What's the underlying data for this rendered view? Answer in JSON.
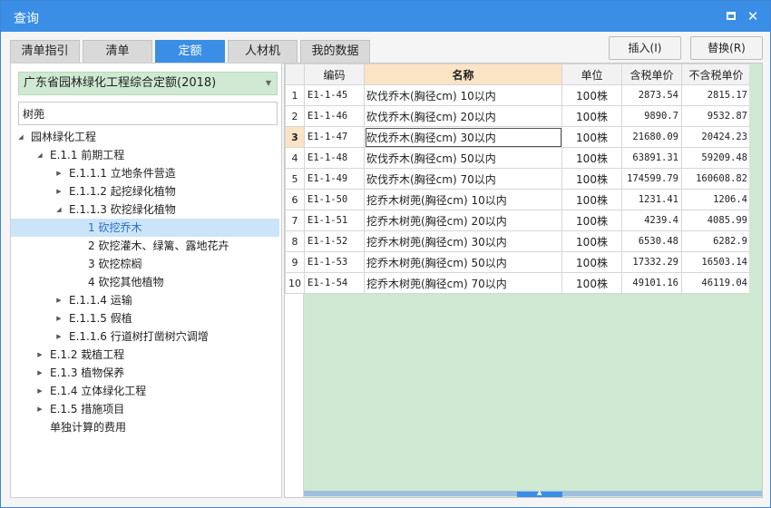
{
  "window": {
    "title": "查询"
  },
  "tabs": [
    "清单指引",
    "清单",
    "定额",
    "人材机",
    "我的数据"
  ],
  "active_tab": 2,
  "actions": {
    "insert": "插入(I)",
    "replace": "替换(R)"
  },
  "left": {
    "select_value": "广东省园林绿化工程综合定额(2018)",
    "search_value": "树蔸",
    "tree": [
      {
        "label": "园林绿化工程",
        "level": 0,
        "toggle": "expanded"
      },
      {
        "label": "E.1.1 前期工程",
        "level": 1,
        "toggle": "expanded"
      },
      {
        "label": "E.1.1.1 立地条件营造",
        "level": 2,
        "toggle": "collapsed"
      },
      {
        "label": "E.1.1.2 起挖绿化植物",
        "level": 2,
        "toggle": "collapsed"
      },
      {
        "label": "E.1.1.3 砍挖绿化植物",
        "level": 2,
        "toggle": "expanded"
      },
      {
        "label": "1 砍挖乔木",
        "level": 3,
        "toggle": "none",
        "selected": true
      },
      {
        "label": "2 砍挖灌木、绿篱、露地花卉",
        "level": 3,
        "toggle": "none"
      },
      {
        "label": "3 砍挖棕榈",
        "level": 3,
        "toggle": "none"
      },
      {
        "label": "4 砍挖其他植物",
        "level": 3,
        "toggle": "none"
      },
      {
        "label": "E.1.1.4 运输",
        "level": 2,
        "toggle": "collapsed"
      },
      {
        "label": "E.1.1.5 假植",
        "level": 2,
        "toggle": "collapsed"
      },
      {
        "label": "E.1.1.6 行道树打凿树穴调增",
        "level": 2,
        "toggle": "collapsed"
      },
      {
        "label": "E.1.2 栽植工程",
        "level": 1,
        "toggle": "collapsed"
      },
      {
        "label": "E.1.3 植物保养",
        "level": 1,
        "toggle": "collapsed"
      },
      {
        "label": "E.1.4 立体绿化工程",
        "level": 1,
        "toggle": "collapsed"
      },
      {
        "label": "E.1.5 措施项目",
        "level": 1,
        "toggle": "collapsed"
      },
      {
        "label": "单独计算的费用",
        "level": 1,
        "toggle": "none"
      }
    ]
  },
  "table": {
    "columns": [
      "编码",
      "名称",
      "单位",
      "含税单价",
      "不含税单价"
    ],
    "current_row": 2,
    "rows": [
      [
        "1",
        "E1-1-45",
        "砍伐乔木(胸径cm) 10以内",
        "100株",
        "2873.54",
        "2815.17"
      ],
      [
        "2",
        "E1-1-46",
        "砍伐乔木(胸径cm) 20以内",
        "100株",
        "9890.7",
        "9532.87"
      ],
      [
        "3",
        "E1-1-47",
        "砍伐乔木(胸径cm) 30以内",
        "100株",
        "21680.09",
        "20424.23"
      ],
      [
        "4",
        "E1-1-48",
        "砍伐乔木(胸径cm) 50以内",
        "100株",
        "63891.31",
        "59209.48"
      ],
      [
        "5",
        "E1-1-49",
        "砍伐乔木(胸径cm) 70以内",
        "100株",
        "174599.79",
        "160608.82"
      ],
      [
        "6",
        "E1-1-50",
        "挖乔木树蔸(胸径cm) 10以内",
        "100株",
        "1231.41",
        "1206.4"
      ],
      [
        "7",
        "E1-1-51",
        "挖乔木树蔸(胸径cm) 20以内",
        "100株",
        "4239.4",
        "4085.99"
      ],
      [
        "8",
        "E1-1-52",
        "挖乔木树蔸(胸径cm) 30以内",
        "100株",
        "6530.48",
        "6282.9"
      ],
      [
        "9",
        "E1-1-53",
        "挖乔木树蔸(胸径cm) 50以内",
        "100株",
        "17332.29",
        "16503.14"
      ],
      [
        "10",
        "E1-1-54",
        "挖乔木树蔸(胸径cm) 70以内",
        "100株",
        "49101.16",
        "46119.04"
      ]
    ]
  }
}
